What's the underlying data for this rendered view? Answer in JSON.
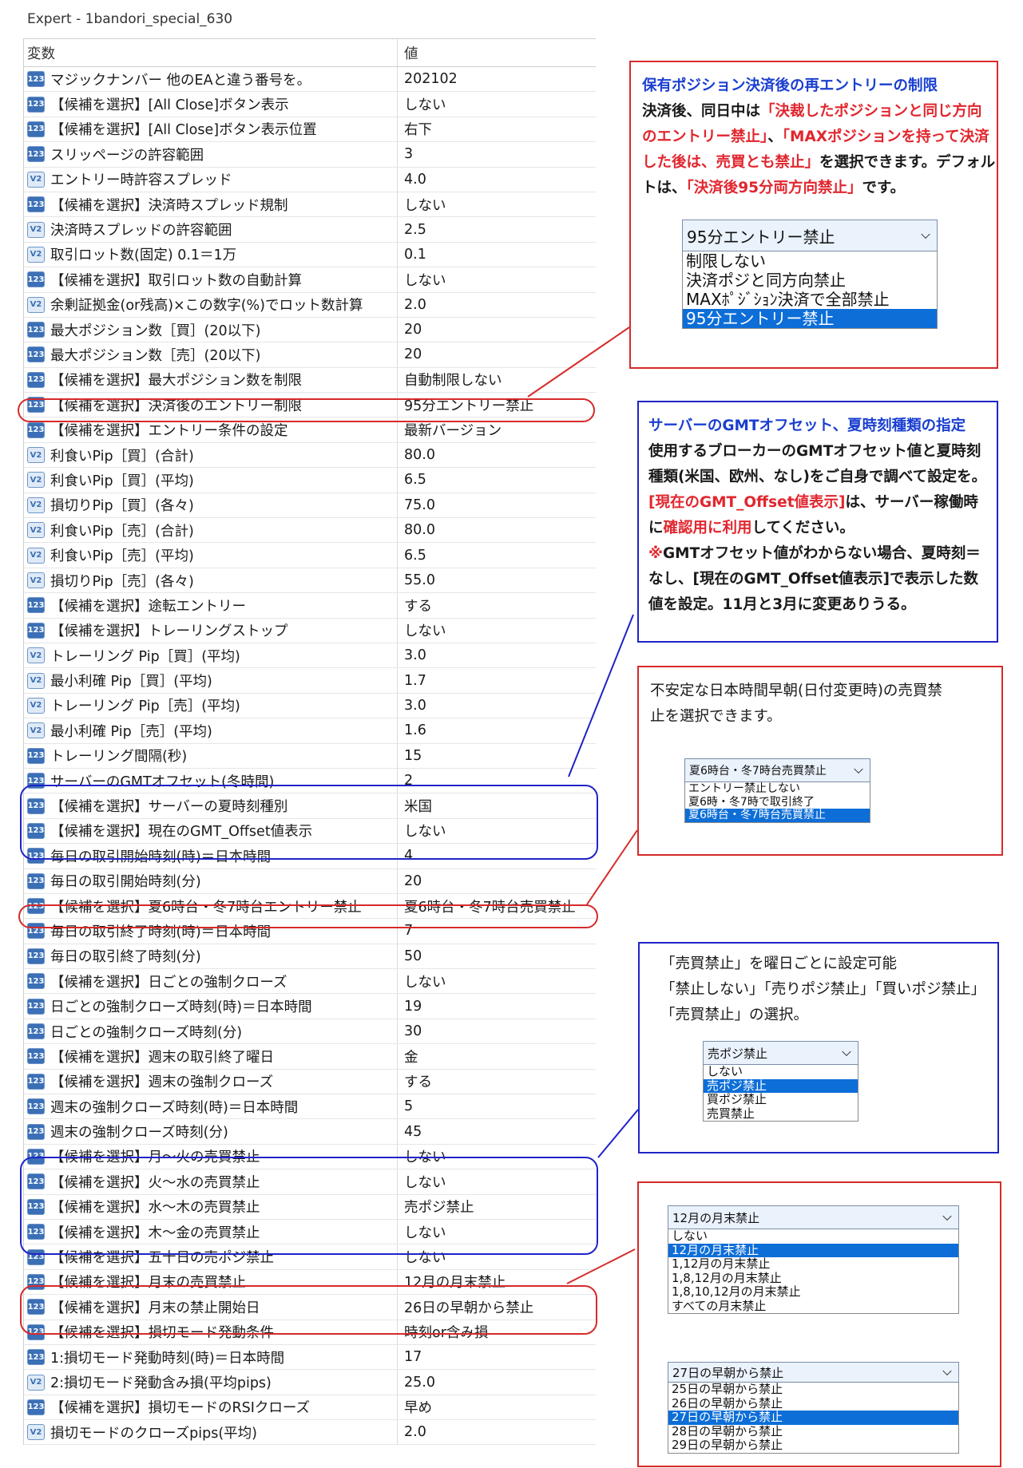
{
  "window": {
    "title": "Expert - 1bandori_special_630"
  },
  "table": {
    "headers": {
      "name": "変数",
      "value": "値"
    },
    "rows": [
      {
        "icon": "123",
        "name": "マジックナンバー 他のEAと違う番号を。",
        "value": "202102"
      },
      {
        "icon": "123",
        "name": "【候補を選択】[All Close]ボタン表示",
        "value": "しない"
      },
      {
        "icon": "123",
        "name": "【候補を選択】[All Close]ボタン表示位置",
        "value": "右下"
      },
      {
        "icon": "123",
        "name": "スリッページの許容範囲",
        "value": "3"
      },
      {
        "icon": "V2",
        "name": "エントリー時許容スプレッド",
        "value": "4.0"
      },
      {
        "icon": "123",
        "name": "【候補を選択】決済時スプレッド規制",
        "value": "しない"
      },
      {
        "icon": "V2",
        "name": "決済時スプレッドの許容範囲",
        "value": "2.5"
      },
      {
        "icon": "V2",
        "name": "取引ロット数(固定) 0.1＝1万",
        "value": "0.1"
      },
      {
        "icon": "123",
        "name": "【候補を選択】取引ロット数の自動計算",
        "value": "しない"
      },
      {
        "icon": "V2",
        "name": "余剰証拠金(or残高)×この数字(%)でロット数計算",
        "value": "2.0"
      },
      {
        "icon": "123",
        "name": "最大ポジション数［買］(20以下)",
        "value": "20"
      },
      {
        "icon": "123",
        "name": "最大ポジション数［売］(20以下)",
        "value": "20"
      },
      {
        "icon": "123",
        "name": "【候補を選択】最大ポジション数を制限",
        "value": "自動制限しない"
      },
      {
        "icon": "123",
        "name": "【候補を選択】決済後のエントリー制限",
        "value": "95分エントリー禁止"
      },
      {
        "icon": "123",
        "name": "【候補を選択】エントリー条件の設定",
        "value": "最新バージョン"
      },
      {
        "icon": "V2",
        "name": "利食いPip［買］(合計)",
        "value": "80.0"
      },
      {
        "icon": "V2",
        "name": "利食いPip［買］(平均)",
        "value": "6.5"
      },
      {
        "icon": "V2",
        "name": "損切りPip［買］(各々)",
        "value": "75.0"
      },
      {
        "icon": "V2",
        "name": "利食いPip［売］(合計)",
        "value": "80.0"
      },
      {
        "icon": "V2",
        "name": "利食いPip［売］(平均)",
        "value": "6.5"
      },
      {
        "icon": "V2",
        "name": "損切りPip［売］(各々)",
        "value": "55.0"
      },
      {
        "icon": "123",
        "name": "【候補を選択】途転エントリー",
        "value": "する"
      },
      {
        "icon": "123",
        "name": "【候補を選択】トレーリングストップ",
        "value": "しない"
      },
      {
        "icon": "V2",
        "name": "トレーリング Pip［買］(平均)",
        "value": "3.0"
      },
      {
        "icon": "V2",
        "name": "最小利確 Pip［買］(平均)",
        "value": "1.7"
      },
      {
        "icon": "V2",
        "name": "トレーリング Pip［売］(平均)",
        "value": "3.0"
      },
      {
        "icon": "V2",
        "name": "最小利確 Pip［売］(平均)",
        "value": "1.6"
      },
      {
        "icon": "123",
        "name": "トレーリング間隔(秒)",
        "value": "15"
      },
      {
        "icon": "123",
        "name": "サーバーのGMTオフセット(冬時間)",
        "value": "2"
      },
      {
        "icon": "123",
        "name": "【候補を選択】サーバーの夏時刻種別",
        "value": "米国"
      },
      {
        "icon": "123",
        "name": "【候補を選択】現在のGMT_Offset値表示",
        "value": "しない"
      },
      {
        "icon": "123",
        "name": "毎日の取引開始時刻(時)＝日本時間",
        "value": "4"
      },
      {
        "icon": "123",
        "name": "毎日の取引開始時刻(分)",
        "value": "20"
      },
      {
        "icon": "123",
        "name": "【候補を選択】夏6時台・冬7時台エントリー禁止",
        "value": "夏6時台・冬7時台売買禁止"
      },
      {
        "icon": "123",
        "name": "毎日の取引終了時刻(時)＝日本時間",
        "value": "7"
      },
      {
        "icon": "123",
        "name": "毎日の取引終了時刻(分)",
        "value": "50"
      },
      {
        "icon": "123",
        "name": "【候補を選択】日ごとの強制クローズ",
        "value": "しない"
      },
      {
        "icon": "123",
        "name": "日ごとの強制クローズ時刻(時)＝日本時間",
        "value": "19"
      },
      {
        "icon": "123",
        "name": "日ごとの強制クローズ時刻(分)",
        "value": "30"
      },
      {
        "icon": "123",
        "name": "【候補を選択】週末の取引終了曜日",
        "value": "金"
      },
      {
        "icon": "123",
        "name": "【候補を選択】週末の強制クローズ",
        "value": "する"
      },
      {
        "icon": "123",
        "name": "週末の強制クローズ時刻(時)＝日本時間",
        "value": "5"
      },
      {
        "icon": "123",
        "name": "週末の強制クローズ時刻(分)",
        "value": "45"
      },
      {
        "icon": "123",
        "name": "【候補を選択】月～火の売買禁止",
        "value": "しない"
      },
      {
        "icon": "123",
        "name": "【候補を選択】火～水の売買禁止",
        "value": "しない"
      },
      {
        "icon": "123",
        "name": "【候補を選択】水～木の売買禁止",
        "value": "売ポジ禁止"
      },
      {
        "icon": "123",
        "name": "【候補を選択】木～金の売買禁止",
        "value": "しない"
      },
      {
        "icon": "123",
        "name": "【候補を選択】五十日の売ポジ禁止",
        "value": "しない"
      },
      {
        "icon": "123",
        "name": "【候補を選択】月末の売買禁止",
        "value": "12月の月末禁止"
      },
      {
        "icon": "123",
        "name": "【候補を選択】月末の禁止開始日",
        "value": "26日の早朝から禁止"
      },
      {
        "icon": "123",
        "name": "【候補を選択】損切モード発動条件",
        "value": "時刻or含み損"
      },
      {
        "icon": "123",
        "name": "1:損切モード発動時刻(時)＝日本時間",
        "value": "17"
      },
      {
        "icon": "V2",
        "name": "2:損切モード発動含み損(平均pips)",
        "value": "25.0"
      },
      {
        "icon": "123",
        "name": "【候補を選択】損切モードのRSIクローズ",
        "value": "早め"
      },
      {
        "icon": "V2",
        "name": "損切モードのクローズpips(平均)",
        "value": "2.0"
      }
    ]
  },
  "annotations": {
    "reentry": {
      "title": "保有ポジション決済後の再エントリーの制限",
      "line1": "決済後、同日中は",
      "red1": "「決裁したポジションと同じ方向",
      "red2": "のエントリー禁止」",
      "mid2": "、",
      "red3": "「MAXポジションを持って決済",
      "red4": "した後は、売買とも禁止」",
      "tail3": "を選択できます。デフォル",
      "line4a": "トは、",
      "red5": "「決済後95分両方向禁止」",
      "line4b": "です。"
    },
    "gmt": {
      "title": "サーバーのGMTオフセット、夏時刻種類の指定",
      "line1": "使用するブローカーのGMTオフセット値と夏時刻",
      "line2": "種類(米国、欧州、なし)をご自身で調べて設定を。",
      "red1": "[現在のGMT_Offset値表示]",
      "line3": "は、サーバー稼働時",
      "line4a": "に",
      "red2": "確認用に利用",
      "line4b": "してください。",
      "note_mark": "※",
      "line5": "GMTオフセット値がわからない場合、夏時刻＝",
      "line6": "なし、[現在のGMT_Offset値表示]で表示した数",
      "line7": "値を設定。11月と3月に変更ありうる。"
    },
    "morning": {
      "line1": "不安定な日本時間早朝(日付変更時)の売買禁",
      "line2": "止を選択できます。"
    },
    "weekday": {
      "line1": "「売買禁止」を曜日ごとに設定可能",
      "line2": "「禁止しない」「売りポジ禁止」「買いポジ禁止」",
      "line3": "「売買禁止」の選択。"
    }
  },
  "dropdowns": {
    "reentry": {
      "selected": "95分エントリー禁止",
      "options": [
        "制限しない",
        "決済ポジと同方向禁止",
        "MAXﾎﾟｼﾞｼｮﾝ決済で全部禁止",
        "95分エントリー禁止"
      ],
      "selected_index": 3
    },
    "morning": {
      "selected": "夏6時台・冬7時台売買禁止",
      "options": [
        "エントリー禁止しない",
        "夏6時・冬7時で取引終了",
        "夏6時台・冬7時台売買禁止"
      ],
      "selected_index": 2
    },
    "weekday": {
      "selected": "売ポジ禁止",
      "options": [
        "しない",
        "売ポジ禁止",
        "買ポジ禁止",
        "売買禁止"
      ],
      "selected_index": 1
    },
    "month_end": {
      "selected": "12月の月末禁止",
      "options": [
        "しない",
        "12月の月末禁止",
        "1,12月の月末禁止",
        "1,8,12月の月末禁止",
        "1,8,10,12月の月末禁止",
        "すべての月末禁止"
      ],
      "selected_index": 1
    },
    "start_day": {
      "selected": "27日の早朝から禁止",
      "options": [
        "25日の早朝から禁止",
        "26日の早朝から禁止",
        "27日の早朝から禁止",
        "28日の早朝から禁止",
        "29日の早朝から禁止"
      ],
      "selected_index": 2
    }
  },
  "colors": {
    "red": "#d62a2a",
    "blue": "#1f23c8",
    "highlight": "#0d6ed8"
  }
}
